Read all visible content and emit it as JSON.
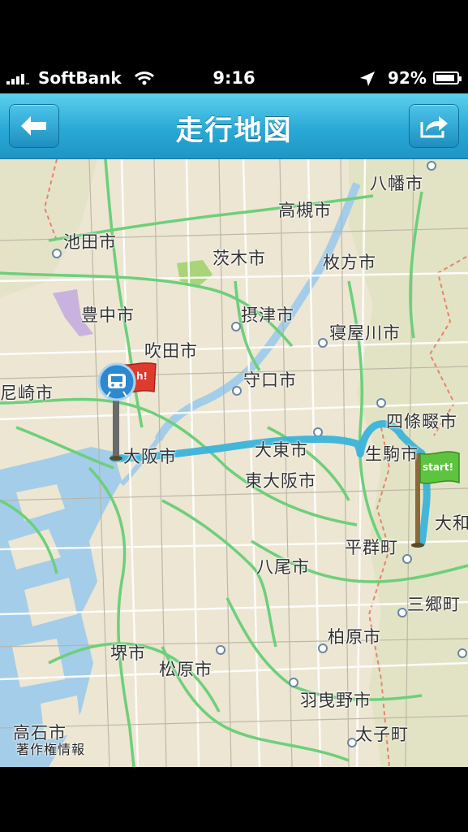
{
  "status": {
    "carrier": "SoftBank",
    "time": "9:16",
    "battery": "92%",
    "battery_level": 0.92
  },
  "nav": {
    "title": "走行地図",
    "back_icon": "back-arrow-icon",
    "share_icon": "share-icon"
  },
  "map": {
    "attribution": "著作権情報",
    "places": [
      {
        "name": "八幡市"
      },
      {
        "name": "高槻市"
      },
      {
        "name": "池田市"
      },
      {
        "name": "茨木市"
      },
      {
        "name": "枚方市"
      },
      {
        "name": "豊中市"
      },
      {
        "name": "摂津市"
      },
      {
        "name": "吹田市"
      },
      {
        "name": "寝屋川市"
      },
      {
        "name": "尼崎市"
      },
      {
        "name": "守口市"
      },
      {
        "name": "四條畷市"
      },
      {
        "name": "大阪市"
      },
      {
        "name": "大東市"
      },
      {
        "name": "生駒市"
      },
      {
        "name": "東大阪市"
      },
      {
        "name": "大和"
      },
      {
        "name": "平群町"
      },
      {
        "name": "八尾市"
      },
      {
        "name": "三郷町"
      },
      {
        "name": "柏原市"
      },
      {
        "name": "堺市"
      },
      {
        "name": "松原市"
      },
      {
        "name": "羽曳野市"
      },
      {
        "name": "太子町"
      },
      {
        "name": "高石市"
      }
    ],
    "start_flag": "start!",
    "finish_flag": "h!",
    "colors": {
      "route": "#3bb3da",
      "water": "#a4cde9",
      "highway": "#6dcf7b",
      "boundary": "#e8836a",
      "land": "#ece6d2"
    }
  }
}
